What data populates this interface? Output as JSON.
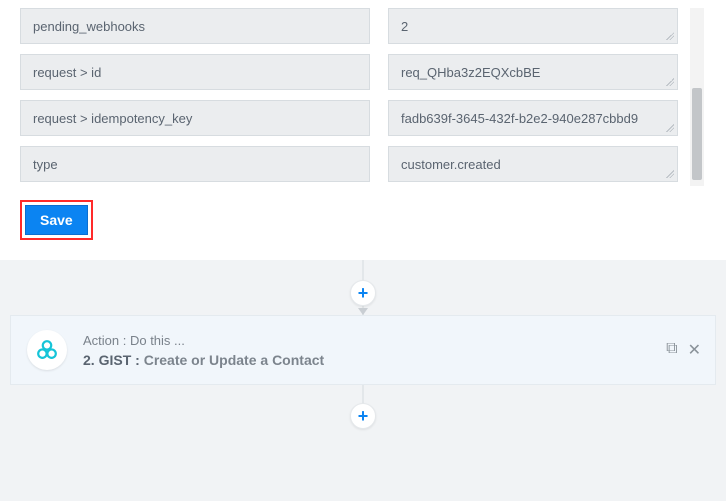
{
  "fields": {
    "rows": [
      {
        "key": "pending_webhooks",
        "value": "2"
      },
      {
        "key": "request > id",
        "value": "req_QHba3z2EQXcbBE"
      },
      {
        "key": "request > idempotency_key",
        "value": "fadb639f-3645-432f-b2e2-940e287cbbd9"
      },
      {
        "key": "type",
        "value": "customer.created"
      }
    ]
  },
  "buttons": {
    "save": "Save"
  },
  "plus_glyph": "+",
  "step": {
    "preline": "Action : Do this ...",
    "number": "2. ",
    "app": "GIST : ",
    "action": "Create or Update a Contact"
  },
  "icons": {
    "copy": "⧉",
    "close": "✕"
  }
}
